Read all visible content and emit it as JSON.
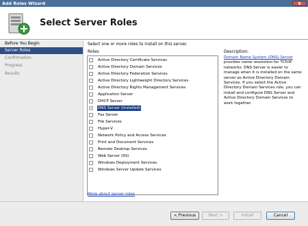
{
  "window": {
    "title": "Add Roles Wizard",
    "close_label": "x"
  },
  "header": {
    "title": "Select Server Roles",
    "icon": "server-roles-icon"
  },
  "sidebar": {
    "items": [
      {
        "label": "Before You Begin",
        "state": "normal"
      },
      {
        "label": "Server Roles",
        "state": "selected"
      },
      {
        "label": "Confirmation",
        "state": "disabled"
      },
      {
        "label": "Progress",
        "state": "disabled"
      },
      {
        "label": "Results",
        "state": "disabled"
      }
    ]
  },
  "main": {
    "instruction": "Select one or more roles to install on this server.",
    "roles_label": "Roles:",
    "description_label": "Description:",
    "roles": [
      {
        "label": "Active Directory Certificate Services",
        "installed": false,
        "selected": false
      },
      {
        "label": "Active Directory Domain Services",
        "installed": false,
        "selected": false
      },
      {
        "label": "Active Directory Federation Services",
        "installed": false,
        "selected": false
      },
      {
        "label": "Active Directory Lightweight Directory Services",
        "installed": false,
        "selected": false
      },
      {
        "label": "Active Directory Rights Management Services",
        "installed": false,
        "selected": false
      },
      {
        "label": "Application Server",
        "installed": false,
        "selected": false
      },
      {
        "label": "DHCP Server",
        "installed": false,
        "selected": false
      },
      {
        "label": "DNS Server  (Installed)",
        "installed": true,
        "selected": true
      },
      {
        "label": "Fax Server",
        "installed": false,
        "selected": false
      },
      {
        "label": "File Services",
        "installed": false,
        "selected": false
      },
      {
        "label": "Hyper-V",
        "installed": false,
        "selected": false
      },
      {
        "label": "Network Policy and Access Services",
        "installed": false,
        "selected": false
      },
      {
        "label": "Print and Document Services",
        "installed": false,
        "selected": false
      },
      {
        "label": "Remote Desktop Services",
        "installed": false,
        "selected": false
      },
      {
        "label": "Web Server (IIS)",
        "installed": false,
        "selected": false
      },
      {
        "label": "Windows Deployment Services",
        "installed": false,
        "selected": false
      },
      {
        "label": "Windows Server Update Services",
        "installed": false,
        "selected": false
      }
    ],
    "description_link": "Domain Name System (DNS) Server",
    "description_text": " provides name resolution for TCP/IP networks. DNS Server is easier to manage when it is installed on the same server as Active Directory Domain Services. If you select the Active Directory Domain Services role, you can install and configure DNS Server and Active Directory Domain Services to work together.",
    "more_link": "More about server roles"
  },
  "footer": {
    "previous": "< Previous",
    "next": "Next >",
    "install": "Install",
    "cancel": "Cancel"
  },
  "colors": {
    "titlebar": "#4a6f9c",
    "nav_selected": "#2f4f86",
    "link": "#1a3fbf",
    "selection": "#1d3f86"
  }
}
